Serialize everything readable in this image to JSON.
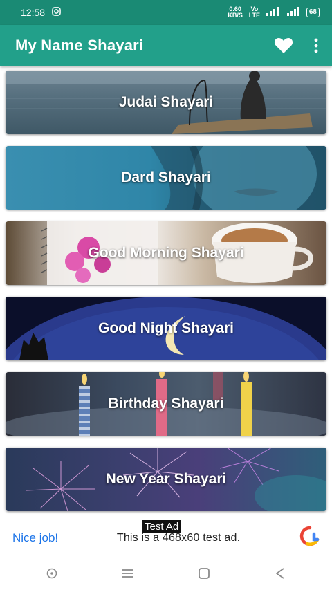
{
  "status_bar": {
    "time": "12:58",
    "speed_value": "0.60",
    "speed_unit": "KB/S",
    "network_type": "Vo LTE",
    "battery": "68"
  },
  "app_bar": {
    "title": "My Name Shayari",
    "favorite_icon": "heart-icon",
    "menu_icon": "more-vert-icon"
  },
  "categories": [
    {
      "label": "Judai Shayari"
    },
    {
      "label": "Dard Shayari"
    },
    {
      "label": "Good Morning Shayari"
    },
    {
      "label": "Good Night Shayari"
    },
    {
      "label": "Birthday Shayari"
    },
    {
      "label": "New Year Shayari"
    }
  ],
  "ad": {
    "tag": "Test Ad",
    "nice": "Nice job!",
    "text": "This is a 468x60 test ad."
  },
  "colors": {
    "status_bar": "#1a8a74",
    "app_bar": "#22a08a",
    "ad_link": "#1a73e8"
  }
}
